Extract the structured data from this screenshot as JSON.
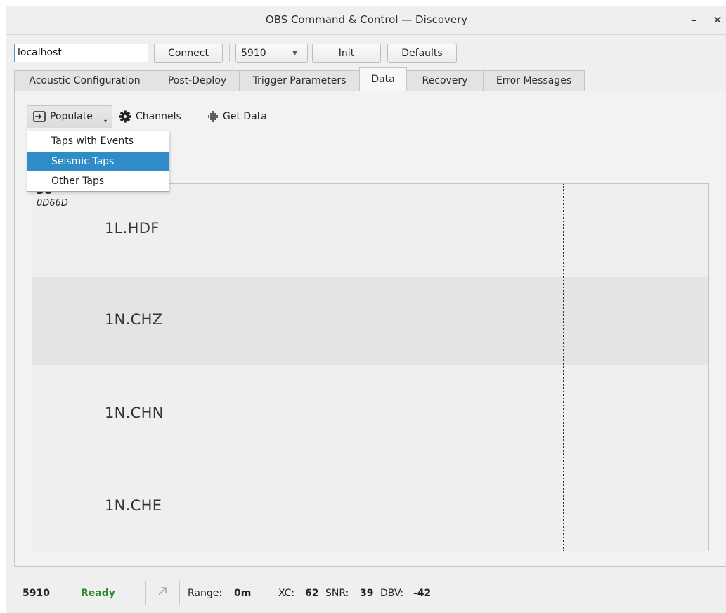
{
  "window": {
    "title": "OBS Command & Control — Discovery",
    "minimize_glyph": "–",
    "close_glyph": "✕"
  },
  "connection": {
    "host_value": "localhost",
    "connect_label": "Connect",
    "port_value": "5910",
    "init_label": "Init",
    "defaults_label": "Defaults"
  },
  "tabs": [
    {
      "label": "Acoustic Configuration",
      "active": false
    },
    {
      "label": "Post-Deploy",
      "active": false
    },
    {
      "label": "Trigger Parameters",
      "active": false
    },
    {
      "label": "Data",
      "active": true
    },
    {
      "label": "Recovery",
      "active": false
    },
    {
      "label": "Error Messages",
      "active": false
    }
  ],
  "data_toolbar": {
    "populate_label": "Populate",
    "channels_label": "Channels",
    "get_data_label": "Get Data"
  },
  "populate_menu": {
    "items": [
      {
        "label": "Taps with Events",
        "selected": false
      },
      {
        "label": "Seismic Taps",
        "selected": true
      },
      {
        "label": "Other Taps",
        "selected": false
      }
    ]
  },
  "plot": {
    "station": "DG",
    "station_id": "0D66D",
    "channels": [
      "1L.HDF",
      "1N.CHZ",
      "1N.CHN",
      "1N.CHE"
    ]
  },
  "status": {
    "port": "5910",
    "state": "Ready",
    "range_label": "Range:",
    "range_value": "0m",
    "xc_label": "XC:",
    "xc_value": "62",
    "snr_label": "SNR:",
    "snr_value": "39",
    "dbv_label": "DBV:",
    "dbv_value": "-42"
  },
  "colors": {
    "selection": "#308cc6",
    "ready": "#2a8a2a",
    "input_focus": "#5b95d6"
  }
}
